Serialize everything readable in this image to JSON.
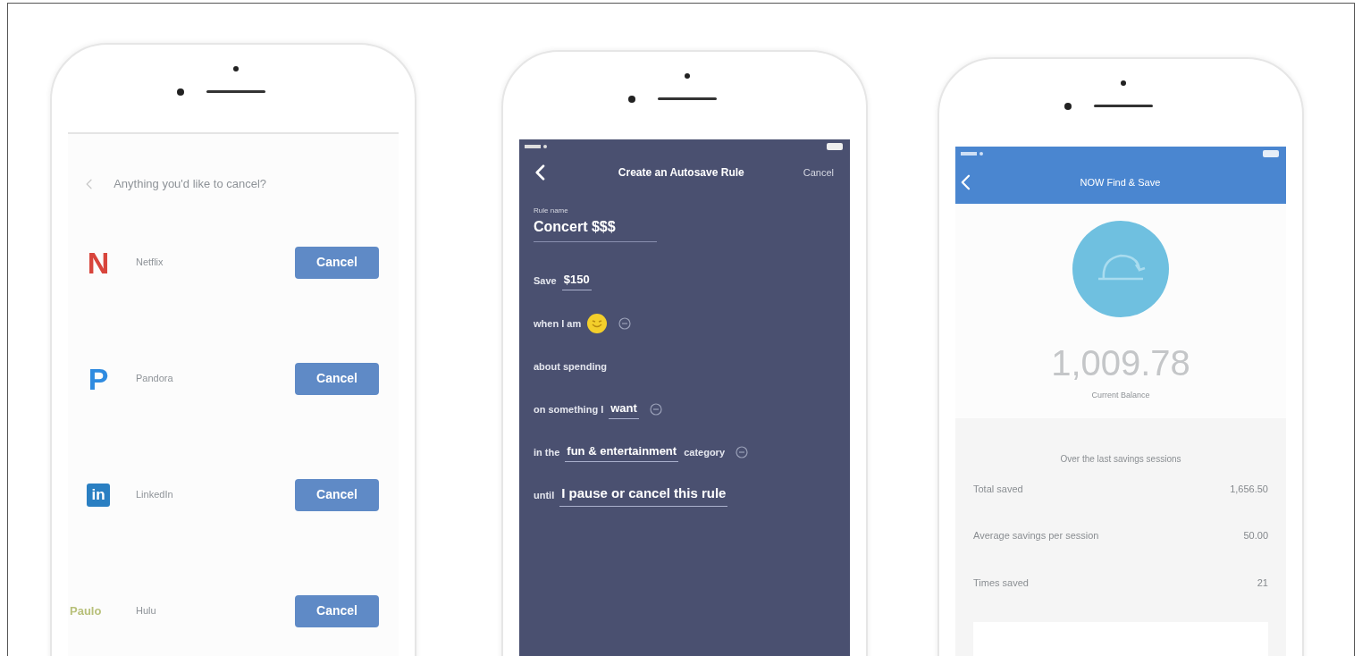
{
  "phones": [
    {
      "kind": "cancel_list",
      "title": "Anything you'd like to cancel?",
      "services": [
        {
          "name": "Netflix",
          "logo": "N",
          "kind": "letter",
          "color": "#d8453c",
          "button": "Cancel"
        },
        {
          "name": "Pandora",
          "logo": "P",
          "kind": "letter",
          "color": "#2f8be0",
          "button": "Cancel"
        },
        {
          "name": "LinkedIn",
          "logo": "in",
          "kind": "tile",
          "color": "#2a7fc2",
          "button": "Cancel"
        },
        {
          "name": "Hulu",
          "logo": "Paulo",
          "kind": "word",
          "color": "#b8c07a",
          "button": "Cancel"
        }
      ]
    },
    {
      "kind": "rule_form",
      "title": "Create an Autosave Rule",
      "action": "Cancel",
      "field_label": "Rule name",
      "field_value": "Concert $$$",
      "lines": [
        {
          "editable": false,
          "parts": [
            {
              "kind": "plain",
              "text": "Save"
            },
            {
              "kind": "value",
              "text": "$150"
            }
          ]
        },
        {
          "editable": true,
          "parts": [
            {
              "kind": "plain",
              "text": "when I am"
            },
            {
              "kind": "emoji"
            }
          ]
        },
        {
          "editable": false,
          "parts": [
            {
              "kind": "plain",
              "text": "about spending"
            }
          ]
        },
        {
          "editable": true,
          "parts": [
            {
              "kind": "plain",
              "text": "on something I"
            },
            {
              "kind": "value",
              "text": "want"
            }
          ]
        },
        {
          "editable": true,
          "parts": [
            {
              "kind": "plain",
              "text": "in the"
            },
            {
              "kind": "value",
              "text": "fun & entertainment"
            },
            {
              "kind": "plain",
              "text": "category"
            }
          ]
        },
        {
          "editable": false,
          "parts": [
            {
              "kind": "plain",
              "text": "until"
            },
            {
              "kind": "value",
              "text": "I pause or cancel this rule"
            }
          ]
        }
      ]
    },
    {
      "kind": "balance",
      "title": "NOW Find & Save",
      "amount": "1,009.78",
      "caption": "Current Balance",
      "section_title": "Over the last savings sessions",
      "stats": [
        {
          "label": "Total saved",
          "value": "1,656.50"
        },
        {
          "label": "Average savings per session",
          "value": "50.00"
        },
        {
          "label": "Times saved",
          "value": "21"
        }
      ]
    }
  ]
}
